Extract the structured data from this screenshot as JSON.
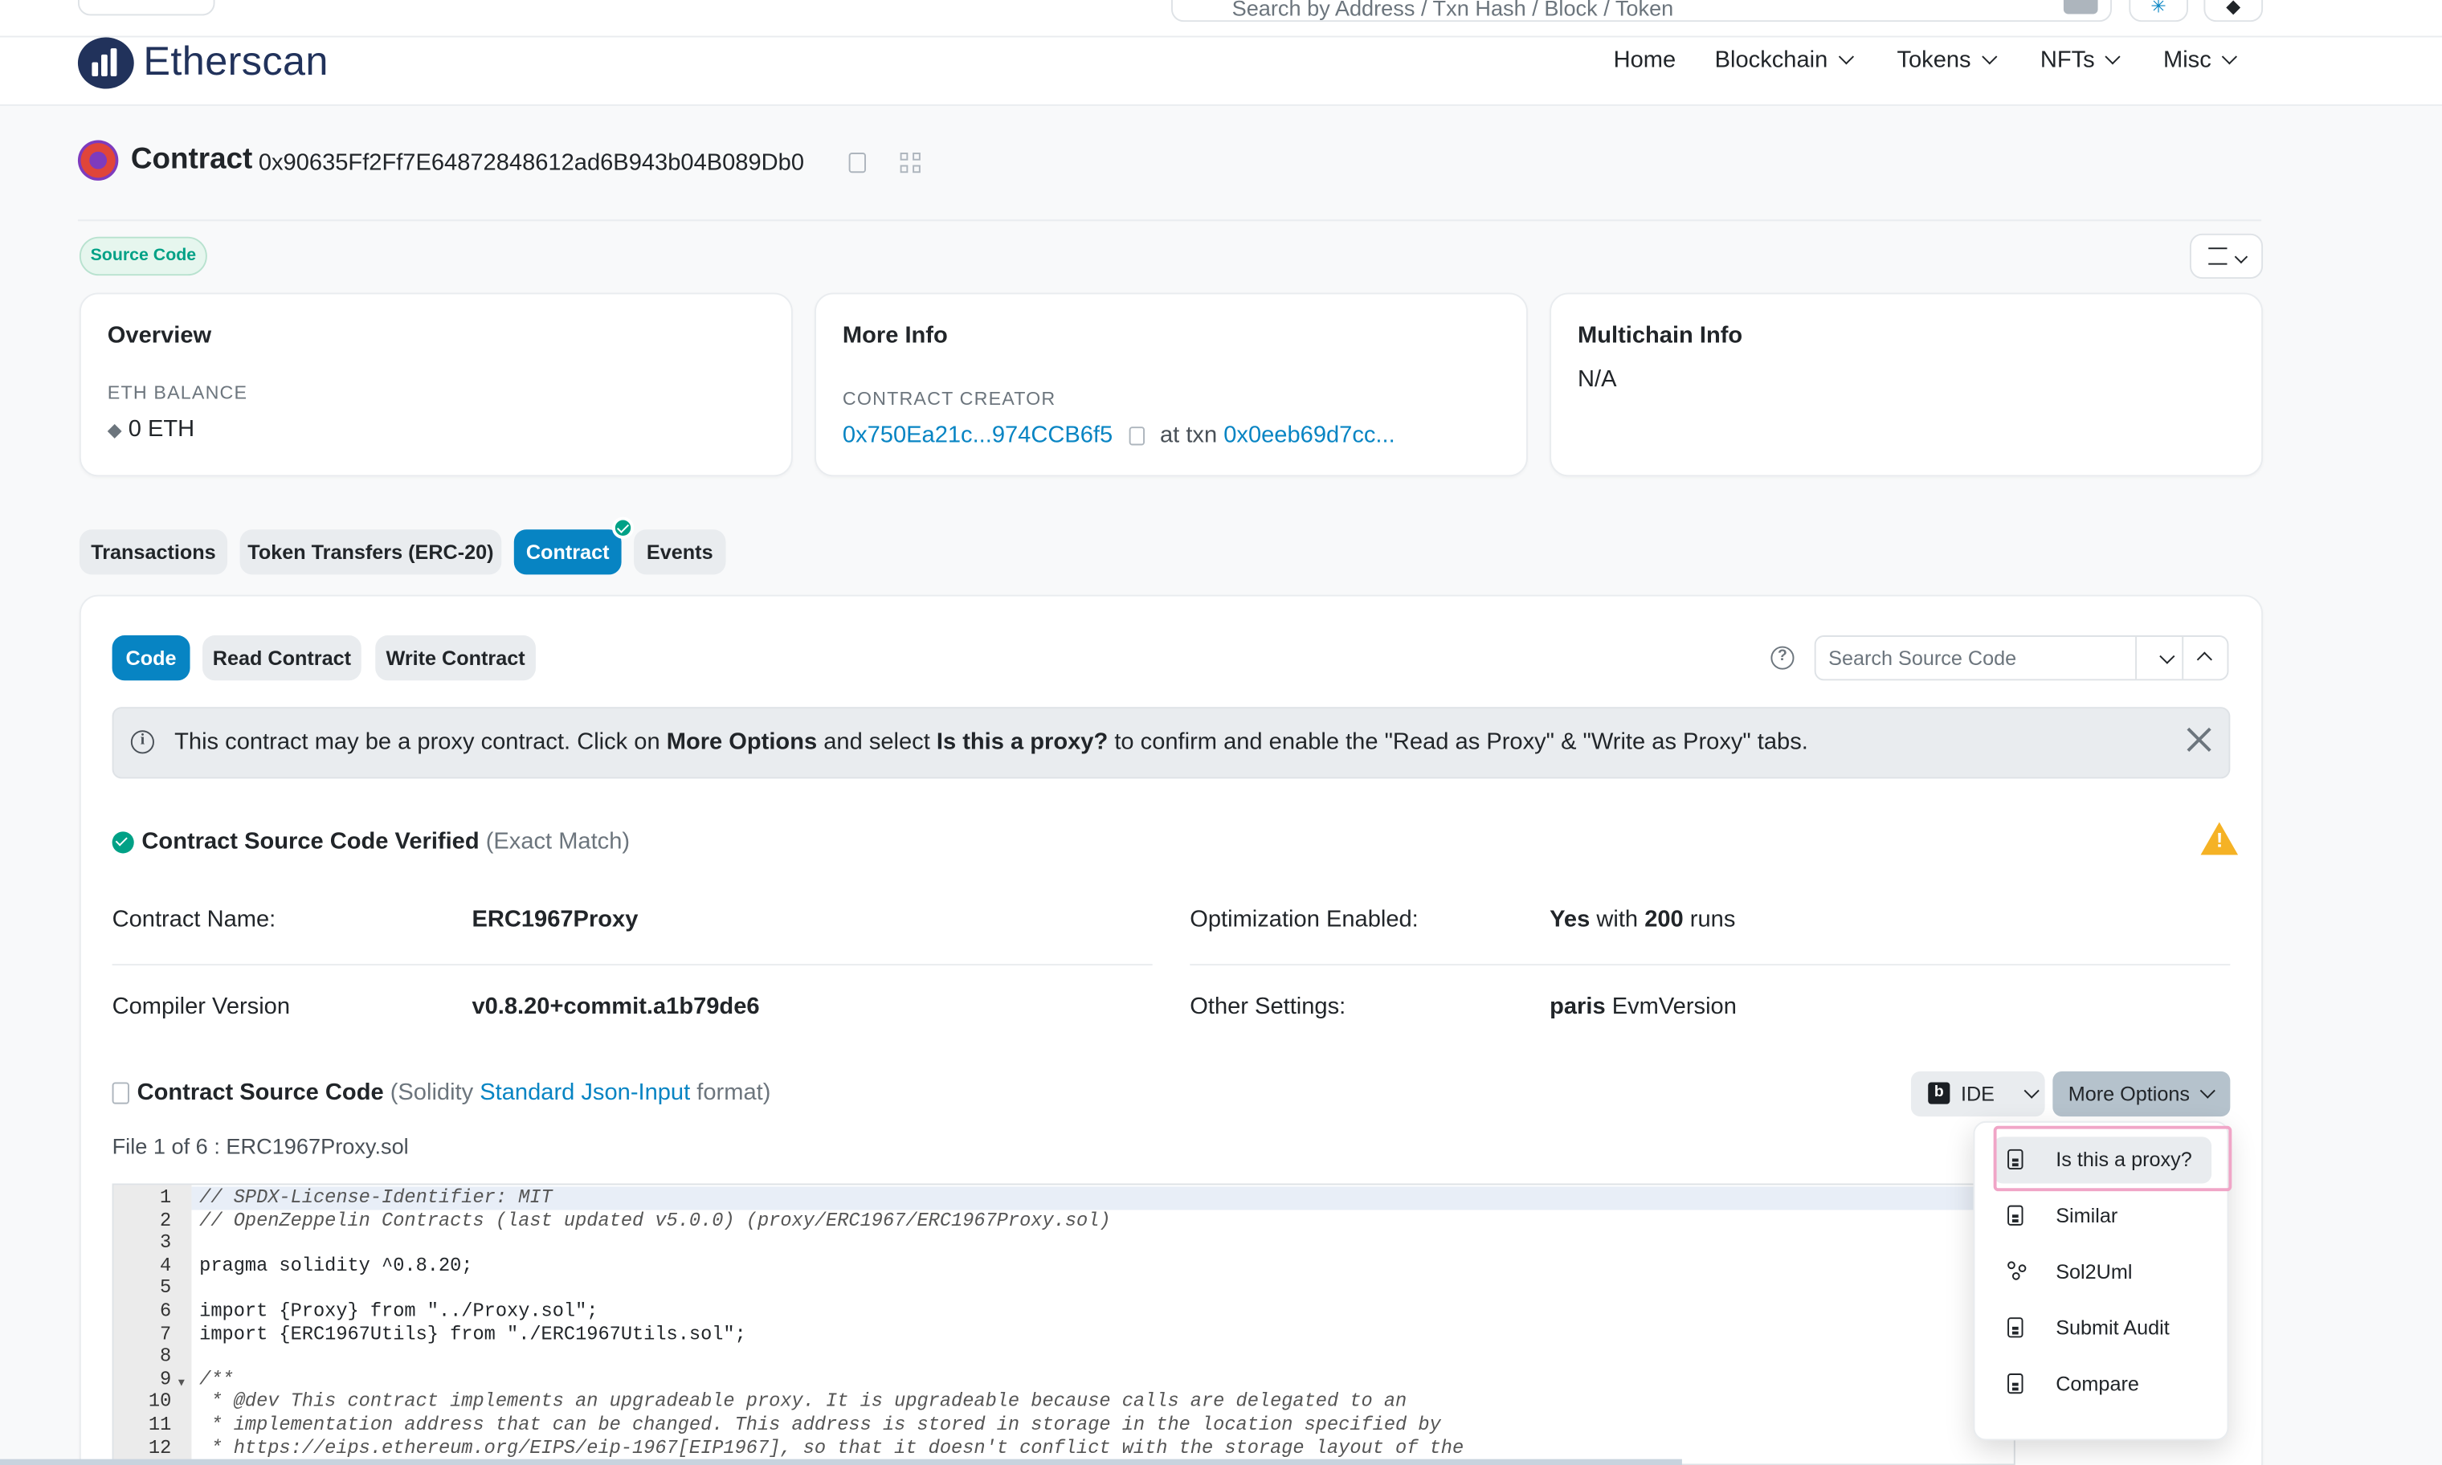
{
  "topbar": {
    "search_placeholder": "Search by Address / Txn Hash / Block / Token"
  },
  "header": {
    "logo_text": "Etherscan",
    "nav": [
      {
        "label": "Home",
        "has_dropdown": false
      },
      {
        "label": "Blockchain",
        "has_dropdown": true
      },
      {
        "label": "Tokens",
        "has_dropdown": true
      },
      {
        "label": "NFTs",
        "has_dropdown": true
      },
      {
        "label": "Misc",
        "has_dropdown": true
      }
    ]
  },
  "contract": {
    "label": "Contract",
    "address": "0x90635Ff2Ff7E64872848612ad6B943b04B089Db0",
    "badge": "Source Code"
  },
  "overview": {
    "title": "Overview",
    "balance_label": "ETH BALANCE",
    "balance_value": "0 ETH"
  },
  "more_info": {
    "title": "More Info",
    "creator_label": "CONTRACT CREATOR",
    "creator_address": "0x750Ea21c...974CCB6f5",
    "at_txn": "at txn",
    "txn_hash": "0x0eeb69d7cc..."
  },
  "multichain": {
    "title": "Multichain Info",
    "value": "N/A"
  },
  "tabs": [
    {
      "label": "Transactions",
      "active": false
    },
    {
      "label": "Token Transfers (ERC-20)",
      "active": false
    },
    {
      "label": "Contract",
      "active": true
    },
    {
      "label": "Events",
      "active": false
    }
  ],
  "subtabs": [
    {
      "label": "Code",
      "active": true
    },
    {
      "label": "Read Contract",
      "active": false
    },
    {
      "label": "Write Contract",
      "active": false
    }
  ],
  "search_source": {
    "placeholder": "Search Source Code"
  },
  "alert": {
    "part1": "This contract may be a proxy contract. Click on ",
    "bold1": "More Options",
    "part2": " and select ",
    "bold2": "Is this a proxy?",
    "part3": " to confirm and enable the \"Read as Proxy\" & \"Write as Proxy\" tabs."
  },
  "verified": {
    "label": "Contract Source Code Verified",
    "match": "(Exact Match)"
  },
  "details": {
    "contract_name_label": "Contract Name:",
    "contract_name": "ERC1967Proxy",
    "compiler_label": "Compiler Version",
    "compiler": "v0.8.20+commit.a1b79de6",
    "optimization_label": "Optimization Enabled:",
    "optimization_yes": "Yes",
    "optimization_with": "with",
    "optimization_runs": "200",
    "optimization_runs_word": "runs",
    "settings_label": "Other Settings:",
    "settings_value": "paris",
    "settings_suffix": "EvmVersion"
  },
  "source": {
    "title": "Contract Source Code",
    "format_prefix": "(Solidity",
    "format_link": "Standard Json-Input",
    "format_suffix": "format)",
    "file_line": "File 1 of 6 : ERC1967Proxy.sol",
    "ide_label": "IDE",
    "more_options": "More Options"
  },
  "code_lines": [
    {
      "n": "1",
      "t": "// SPDX-License-Identifier: MIT"
    },
    {
      "n": "2",
      "t": "// OpenZeppelin Contracts (last updated v5.0.0) (proxy/ERC1967/ERC1967Proxy.sol)"
    },
    {
      "n": "3",
      "t": ""
    },
    {
      "n": "4",
      "t": "pragma solidity ^0.8.20;"
    },
    {
      "n": "5",
      "t": ""
    },
    {
      "n": "6",
      "t": "import {Proxy} from \"../Proxy.sol\";"
    },
    {
      "n": "7",
      "t": "import {ERC1967Utils} from \"./ERC1967Utils.sol\";"
    },
    {
      "n": "8",
      "t": ""
    },
    {
      "n": "9",
      "t": "/**"
    },
    {
      "n": "10",
      "t": " * @dev This contract implements an upgradeable proxy. It is upgradeable because calls are delegated to an"
    },
    {
      "n": "11",
      "t": " * implementation address that can be changed. This address is stored in storage in the location specified by"
    },
    {
      "n": "12",
      "t": " * https://eips.ethereum.org/EIPS/eip-1967[EIP1967], so that it doesn't conflict with the storage layout of the"
    }
  ],
  "dropdown": {
    "items": [
      {
        "label": "Is this a proxy?",
        "icon": "file-icon",
        "active": true
      },
      {
        "label": "Similar",
        "icon": "file-icon",
        "active": false
      },
      {
        "label": "Sol2Uml",
        "icon": "diagram-icon",
        "active": false
      },
      {
        "label": "Submit Audit",
        "icon": "file-icon",
        "active": false
      },
      {
        "label": "Compare",
        "icon": "file-icon",
        "active": false
      }
    ]
  }
}
